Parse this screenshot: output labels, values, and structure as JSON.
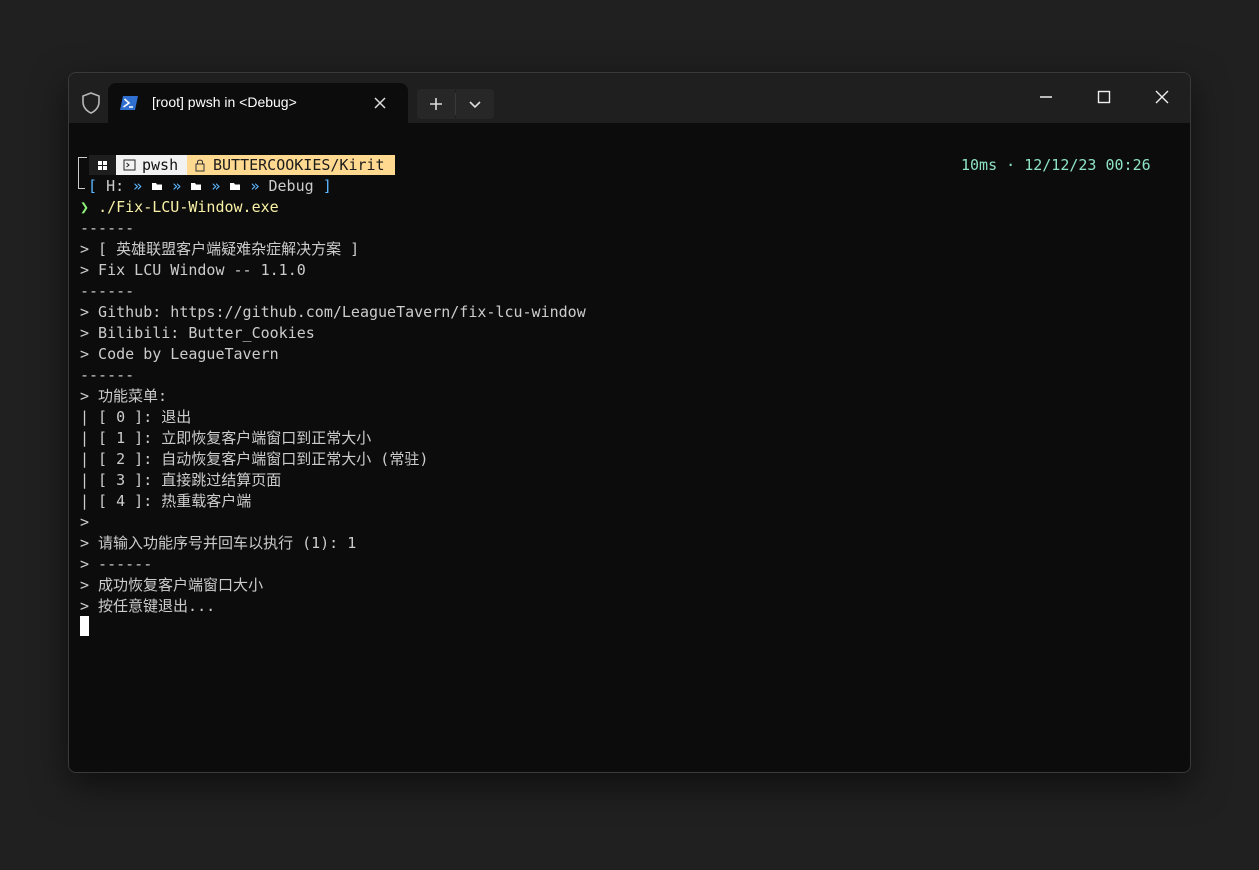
{
  "titlebar": {
    "tab_title": "[root] pwsh in <Debug>",
    "icons": [
      "shield-icon",
      "powershell-icon",
      "close-icon",
      "plus-icon",
      "chevron-down-icon",
      "minimize-icon",
      "maximize-icon",
      "close-icon"
    ]
  },
  "prompt": {
    "shell": "pwsh",
    "user": "BUTTERCOOKIES/Kirit",
    "drive": "H:",
    "folder": "Debug",
    "timing": "10ms · 12/12/23 00:26",
    "command": "./Fix-LCU-Window.exe"
  },
  "output": {
    "lines": [
      "------",
      "> [ 英雄联盟客户端疑难杂症解决方案 ]",
      "> Fix LCU Window -- 1.1.0",
      "------",
      "> Github: https://github.com/LeagueTavern/fix-lcu-window",
      "> Bilibili: Butter_Cookies",
      "> Code by LeagueTavern",
      "------",
      "> 功能菜单:",
      "| [ 0 ]: 退出",
      "| [ 1 ]: 立即恢复客户端窗口到正常大小",
      "| [ 2 ]: 自动恢复客户端窗口到正常大小 (常驻)",
      "| [ 3 ]: 直接跳过结算页面",
      "| [ 4 ]: 热重载客户端",
      ">",
      "> 请输入功能序号并回车以执行 (1): 1",
      "> ------",
      "> 成功恢复客户端窗口大小",
      "> 按任意键退出..."
    ]
  },
  "colors": {
    "terminal_bg": "#0c0c0c",
    "text": "#cccccc",
    "user_segment": "#ffd990",
    "status_text": "#8ee3c4",
    "path_chevrons": "#5cb7ff",
    "command_text": "#f9f1a5",
    "prompt_arrow": "#8ef07a"
  }
}
